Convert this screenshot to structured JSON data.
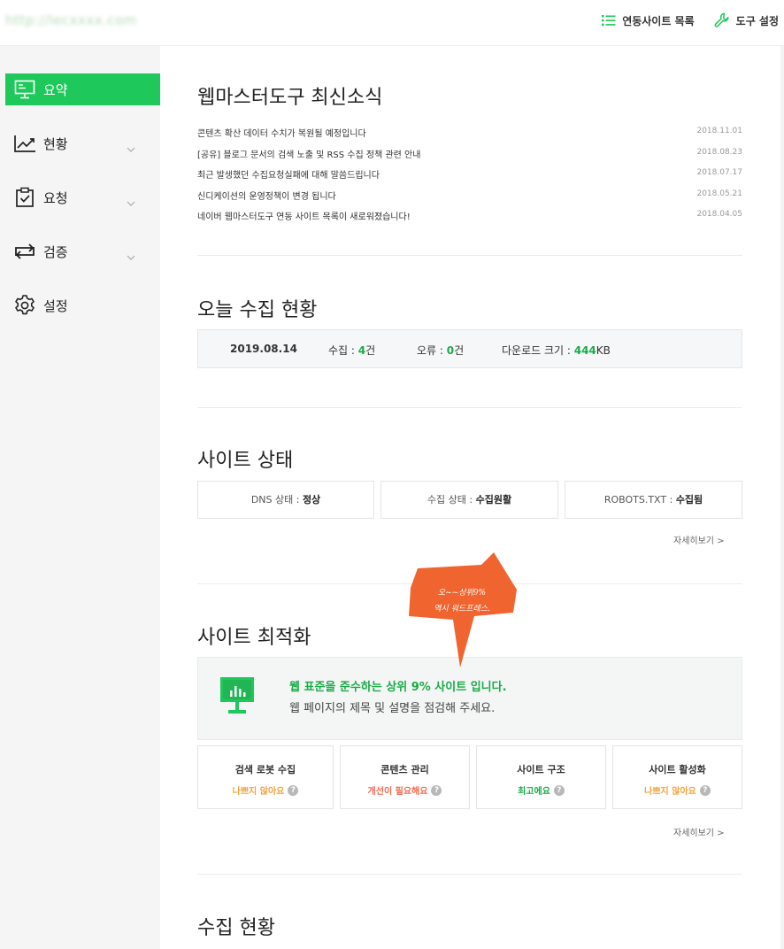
{
  "topbar": {
    "site_url": "http://lecxxxx.com",
    "links": [
      {
        "label": "연동사이트 목록",
        "icon": "list-icon"
      },
      {
        "label": "도구 설정",
        "icon": "wrench-icon"
      }
    ]
  },
  "sidebar": {
    "items": [
      {
        "label": "요약",
        "icon": "monitor-icon",
        "active": true
      },
      {
        "label": "현황",
        "icon": "chart-line-icon",
        "expandable": true
      },
      {
        "label": "요청",
        "icon": "clipboard-check-icon",
        "expandable": true
      },
      {
        "label": "검증",
        "icon": "repeat-icon",
        "expandable": true
      },
      {
        "label": "설정",
        "icon": "gear-icon"
      }
    ]
  },
  "news": {
    "title": "웹마스터도구 최신소식",
    "items": [
      {
        "title": "콘텐츠 확산 데이터 수치가 복원될 예정입니다",
        "date": "2018.11.01"
      },
      {
        "title": "[공유] 블로그 문서의 검색 노출 및 RSS 수집 정책 관련 안내",
        "date": "2018.08.23"
      },
      {
        "title": "최근 발생했던 수집요청실패에 대해 말씀드립니다",
        "date": "2018.07.17"
      },
      {
        "title": "신디케이션의 운영정책이 변경 됩니다",
        "date": "2018.05.21"
      },
      {
        "title": "네이버 웹마스터도구 연동 사이트 목록이 새로워졌습니다!",
        "date": "2018.04.05"
      }
    ]
  },
  "today": {
    "title": "오늘 수집 현황",
    "date": "2019.08.14",
    "collect_label": "수집 : ",
    "collect_value": "4",
    "collect_unit": "건",
    "error_label": "오류 : ",
    "error_value": "0",
    "error_unit": "건",
    "download_label": "다운로드 크기 : ",
    "download_value": "444",
    "download_unit": "KB"
  },
  "site_status": {
    "title": "사이트 상태",
    "boxes": [
      {
        "label": "DNS 상태 : ",
        "value": "정상"
      },
      {
        "label": "수집 상태 : ",
        "value": "수집원활"
      },
      {
        "label": "ROBOTS.TXT : ",
        "value": "수집됨"
      }
    ],
    "more": "자세히보기 >"
  },
  "optimization": {
    "title": "사이트 최적화",
    "headline": "웹 표준을 준수하는 상위 9% 사이트 입니다.",
    "sub": "웹 페이지의 제목 및 설명을 점검해 주세요.",
    "cards": [
      {
        "title": "검색 로봇 수집",
        "value": "나쁘지 않아요",
        "tone": "orange"
      },
      {
        "title": "콘텐츠 관리",
        "value": "개선이 필요해요",
        "tone": "red"
      },
      {
        "title": "사이트 구조",
        "value": "최고에요",
        "tone": "green"
      },
      {
        "title": "사이트 활성화",
        "value": "나쁘지 않아요",
        "tone": "orange"
      }
    ],
    "more": "자세히보기 >",
    "annotation_line1": "오~~상위9%",
    "annotation_line2": "역시 워드프레스.",
    "annotation_color": "#f0642f"
  },
  "collection": {
    "title": "수집 현황"
  },
  "colors": {
    "accent": "#1ec85a",
    "good": "#1aab48",
    "warn": "#f5a23b",
    "bad": "#f46a4f"
  }
}
